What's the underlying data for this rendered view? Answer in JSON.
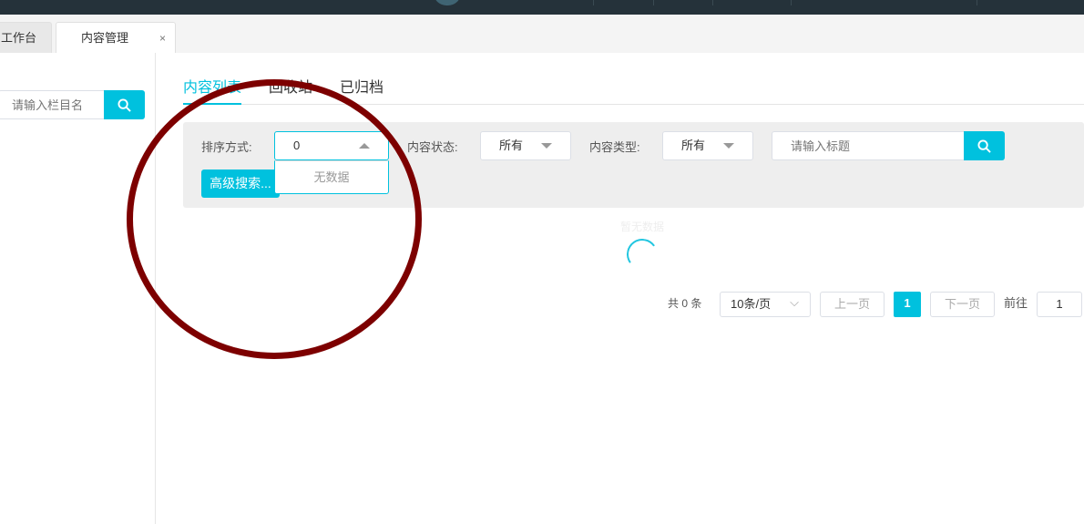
{
  "page_tabs": [
    {
      "label": "工作台"
    },
    {
      "label": "内容管理",
      "close": "×"
    }
  ],
  "sidebar": {
    "search_placeholder": "请输入栏目名"
  },
  "content_tabs": [
    {
      "label": "内容列表"
    },
    {
      "label": "回收站"
    },
    {
      "label": "已归档"
    }
  ],
  "filters": {
    "sort_label": "排序方式:",
    "sort_value": "0",
    "sort_dropdown_empty": "无数据",
    "status_label": "内容状态:",
    "status_value": "所有",
    "type_label": "内容类型:",
    "type_value": "所有",
    "title_placeholder": "请输入标题",
    "advanced_search": "高级搜索..."
  },
  "table": {
    "empty_text": "暂无数据"
  },
  "pagination": {
    "total": "共 0 条",
    "page_size": "10条/页",
    "prev": "上一页",
    "current": "1",
    "next": "下一页",
    "goto_label": "前往",
    "goto_value": "1"
  },
  "colors": {
    "accent": "#00c1de",
    "annotation": "#7d0000",
    "topbar": "#25323a"
  }
}
